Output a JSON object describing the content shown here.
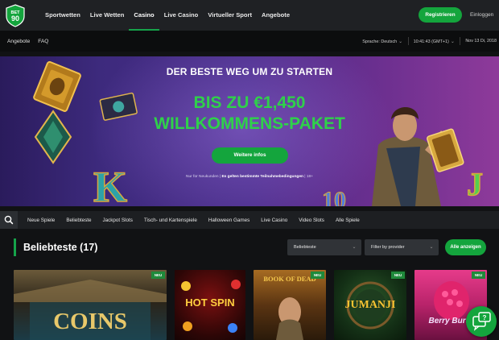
{
  "brand": {
    "logo_text_top": "BET",
    "logo_text_bottom": "90"
  },
  "top_nav": {
    "items": [
      {
        "label": "Sportwetten",
        "active": false
      },
      {
        "label": "Live Wetten",
        "active": false
      },
      {
        "label": "Casino",
        "active": true
      },
      {
        "label": "Live Casino",
        "active": false
      },
      {
        "label": "Virtueller Sport",
        "active": false
      },
      {
        "label": "Angebote",
        "active": false
      }
    ],
    "register_label": "Registrieren",
    "login_label": "Einloggen"
  },
  "sub_nav": {
    "left_items": [
      "Angebote",
      "FAQ"
    ],
    "language_label": "Sprache:",
    "language_value": "Deutsch",
    "time": "10:41:43",
    "timezone": "(GMT+1)",
    "date": "Nov 13 Di, 2018"
  },
  "hero": {
    "headline": "DER BESTE WEG UM ZU STARTEN",
    "amount": "BIS ZU €1,450",
    "package": "WILLKOMMENS-PAKET",
    "cta_label": "Weitere infos",
    "note_prefix": "Nur für Neukunden | ",
    "note_terms": "Es gelten bestimmte Teilnahmebedingungen",
    "note_suffix": " | 18+"
  },
  "category_bar": {
    "search_icon": "search-icon",
    "categories": [
      "Neue Spiele",
      "Beliebteste",
      "Jackpot Slots",
      "Tisch- und Kartenspiele",
      "Halloween Games",
      "Live Casino",
      "Video Slots",
      "Alle Spiele"
    ]
  },
  "popular_section": {
    "title": "Beliebteste (17)",
    "sort_value": "Beliebteste",
    "provider_placeholder": "Filter by provider",
    "show_all_label": "Alle anzeigen"
  },
  "games": [
    {
      "name": "COINS",
      "badge": "NEU"
    },
    {
      "name": "HOT SPIN",
      "badge": ""
    },
    {
      "name": "BOOK OF DEAD",
      "badge": "NEU"
    },
    {
      "name": "JUMANJI",
      "badge": "NEU"
    },
    {
      "name": "Berry Burst",
      "badge": "NEU"
    }
  ],
  "colors": {
    "accent": "#14a53d",
    "hero_green": "#2fd14a",
    "topbar": "#1f2124"
  }
}
